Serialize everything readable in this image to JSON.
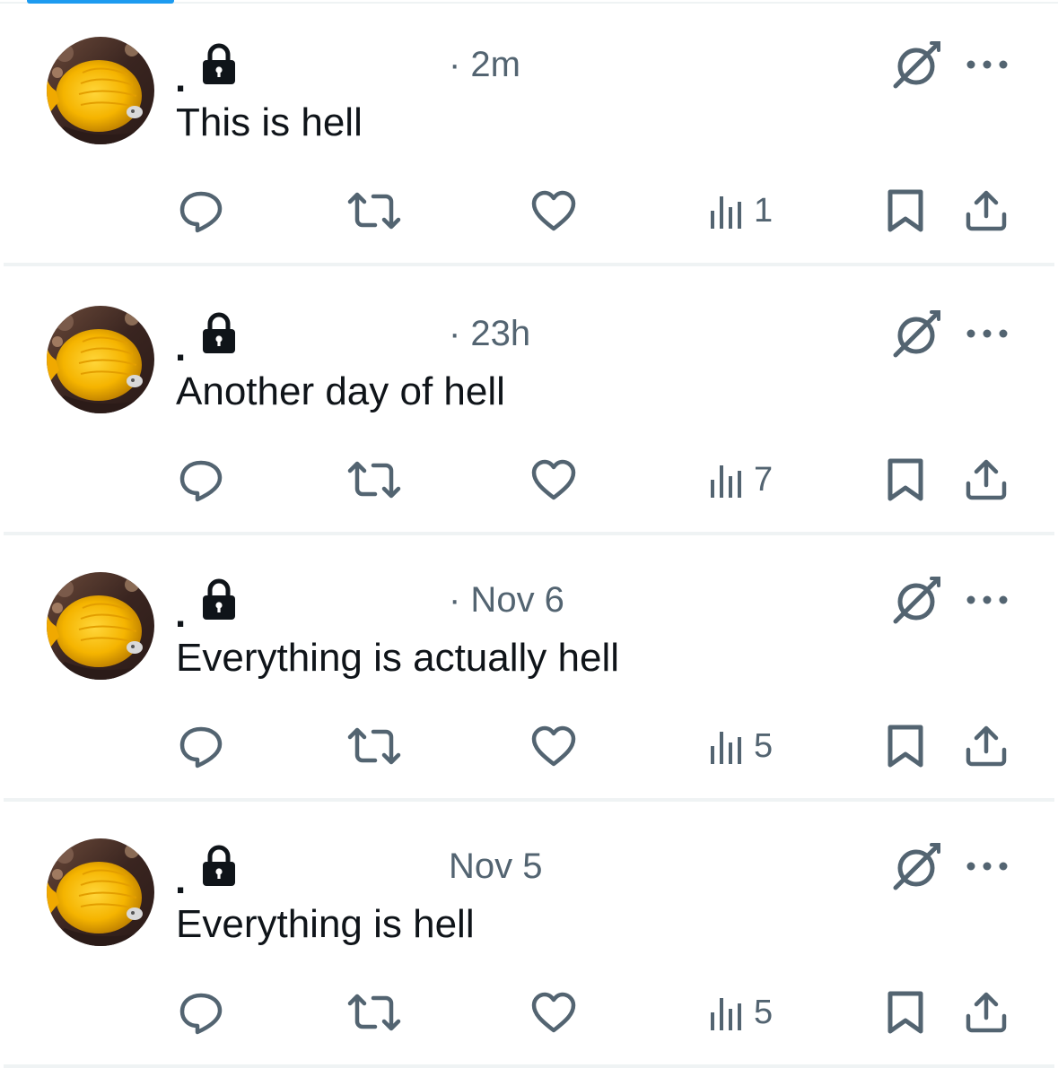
{
  "colors": {
    "accent": "#1d9bf0",
    "icon_gray": "#536471",
    "text": "#0f1419",
    "divider": "#eff3f4",
    "lock": "#0f1419"
  },
  "icons": {
    "reply": "reply-icon",
    "retweet": "retweet-icon",
    "like": "heart-icon",
    "views": "views-icon",
    "bookmark": "bookmark-icon",
    "share": "share-icon",
    "grok": "grok-icon",
    "more": "more-icon",
    "lock": "lock-icon"
  },
  "posts": [
    {
      "display_name": ".",
      "time": "· 2m",
      "text": "This is hell",
      "views": "1"
    },
    {
      "display_name": ".",
      "time": "· 23h",
      "text": "Another day of hell",
      "views": "7"
    },
    {
      "display_name": ".",
      "time": "· Nov 6",
      "text": "Everything is actually hell",
      "views": "5"
    },
    {
      "display_name": ".",
      "time": "Nov 5",
      "text": "Everything is hell",
      "views": "5"
    }
  ]
}
